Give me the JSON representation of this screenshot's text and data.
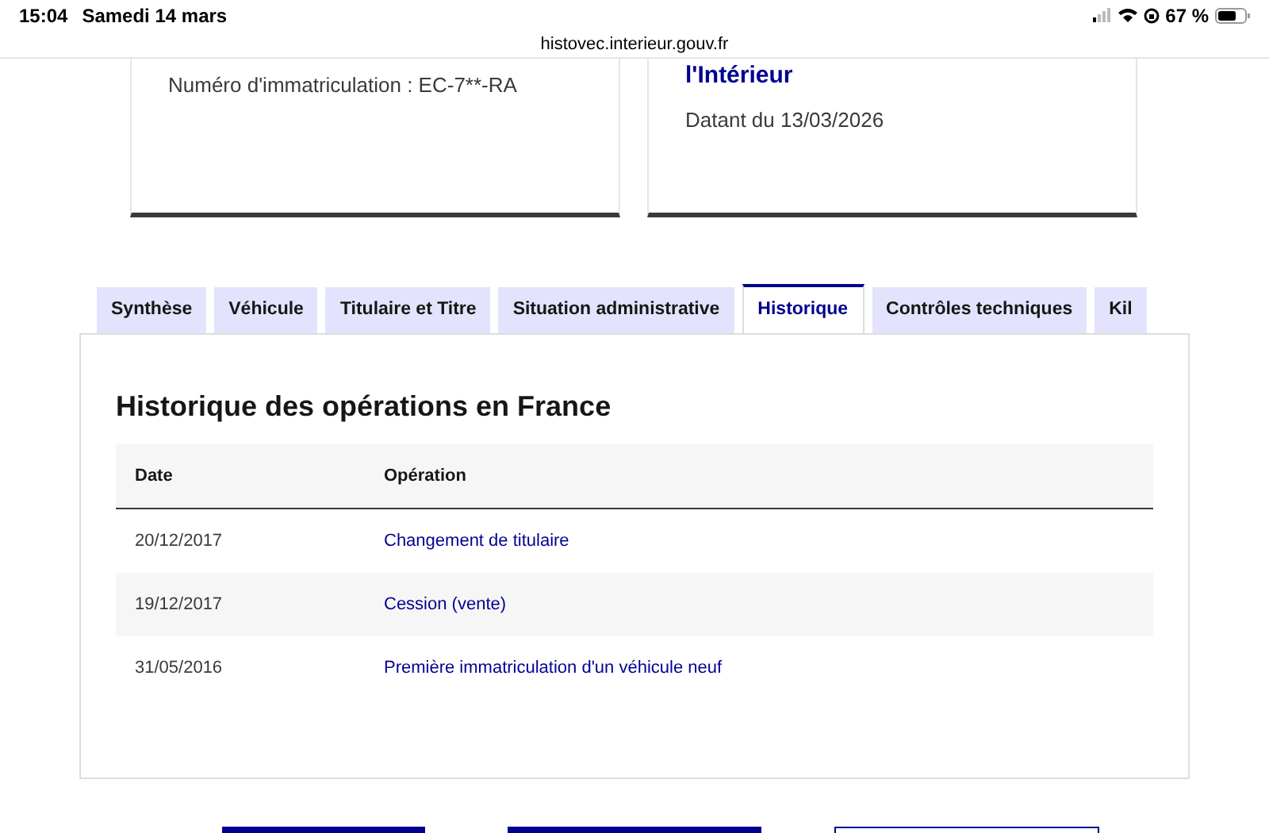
{
  "status_bar": {
    "time": "15:04",
    "date": "Samedi 14 mars",
    "battery": "67 %"
  },
  "address_bar": {
    "url": "histovec.interieur.gouv.fr"
  },
  "cards": [
    {
      "text": "Numéro d'immatriculation : EC-7**-RA"
    },
    {
      "title_lines": [
        "l'Intérieur"
      ],
      "text": "Datant du 13/03/2026"
    }
  ],
  "tabs": [
    {
      "label": "Synthèse",
      "selected": false
    },
    {
      "label": "Véhicule",
      "selected": false
    },
    {
      "label": "Titulaire et Titre",
      "selected": false
    },
    {
      "label": "Situation administrative",
      "selected": false
    },
    {
      "label": "Historique",
      "selected": true
    },
    {
      "label": "Contrôles techniques",
      "selected": false
    },
    {
      "label": "Kil",
      "selected": false
    }
  ],
  "panel": {
    "title": "Historique des opérations en France",
    "table": {
      "columns": [
        "Date",
        "Opération"
      ],
      "rows": [
        {
          "date": "20/12/2017",
          "operation": "Changement de titulaire"
        },
        {
          "date": "19/12/2017",
          "operation": "Cession (vente)"
        },
        {
          "date": "31/05/2016",
          "operation": "Première immatriculation d'un véhicule neuf"
        }
      ]
    }
  },
  "bottom_buttons": [
    {
      "kind": "primary"
    },
    {
      "kind": "primary"
    },
    {
      "kind": "secondary"
    }
  ]
}
